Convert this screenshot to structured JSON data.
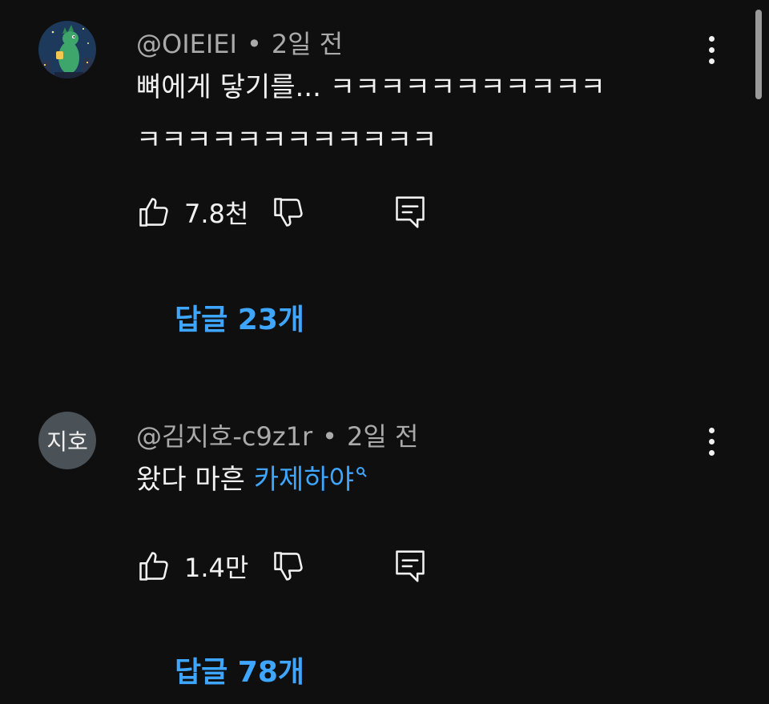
{
  "comments": [
    {
      "author": "@OIEIEI",
      "time": "2일 전",
      "text_line1": "뼈에게 닿기를... ㅋㅋㅋㅋㅋㅋㅋㅋㅋㅋㅋ",
      "text_line2": "ㅋㅋㅋㅋㅋㅋㅋㅋㅋㅋㅋㅋ",
      "likes": "7.8천",
      "replies": "답글 23개",
      "avatar_icon": "green-monster-avatar"
    },
    {
      "author": "@김지호-c9z1r",
      "time": "2일 전",
      "text_prefix": "왔다 마흔 ",
      "text_link": "카제하야",
      "likes": "1.4만",
      "replies": "답글 78개",
      "avatar_initials": "지호"
    }
  ],
  "colors": {
    "background": "#0f0f0f",
    "link": "#3ea6ff",
    "meta_text": "#aaaaaa",
    "text": "#f1f1f1"
  }
}
